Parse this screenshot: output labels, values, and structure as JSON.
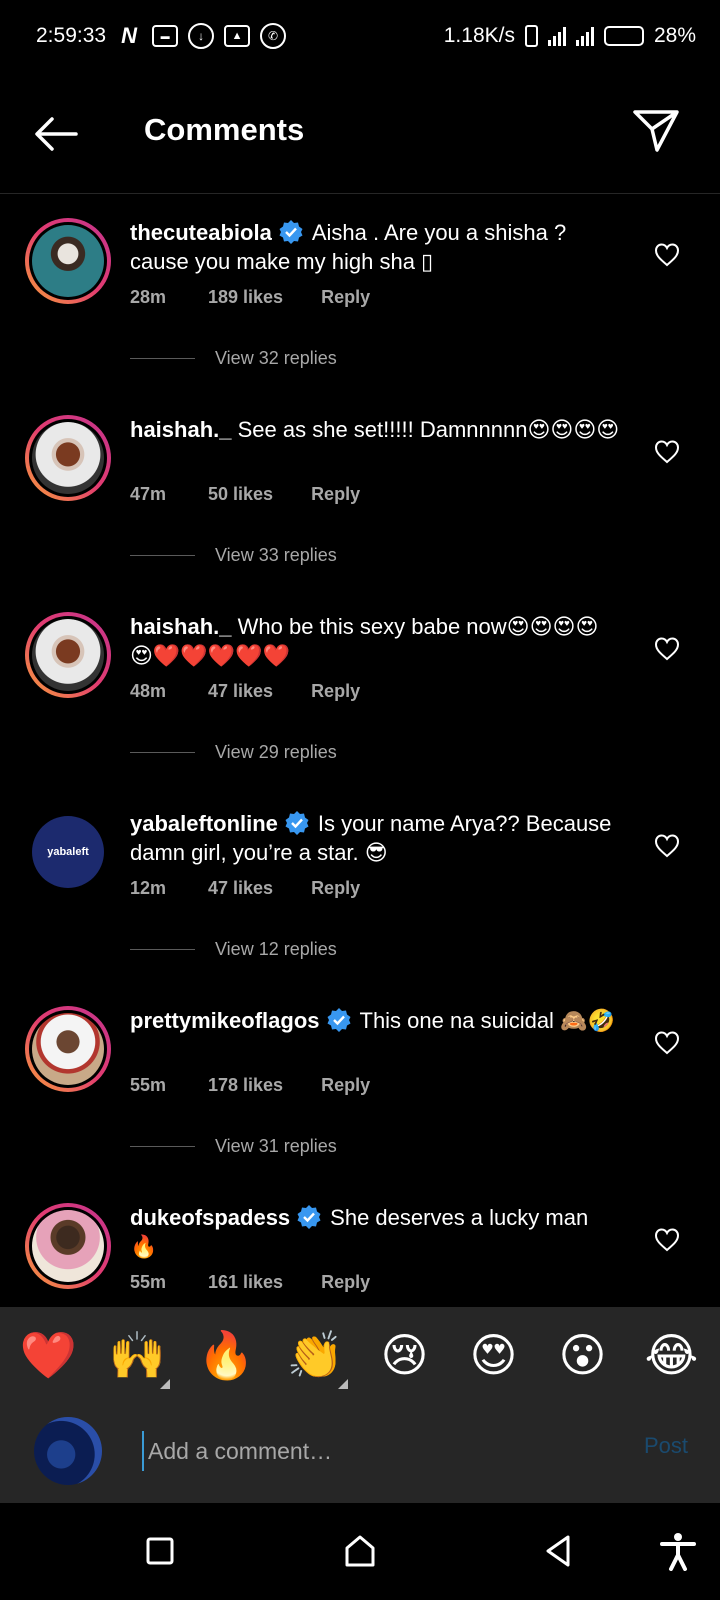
{
  "status_bar": {
    "time": "2:59:33",
    "net_speed": "1.18K/s",
    "battery": "28%",
    "battery_level": 0.28
  },
  "header": {
    "title": "Comments"
  },
  "comments": [
    {
      "username": "thecuteabiola",
      "verified": true,
      "text": "Aisha . Are you a shisha ? cause you make my high sha ▯",
      "time": "28m",
      "likes": "189 likes",
      "reply": "Reply",
      "view_replies": "View 32 replies"
    },
    {
      "username": "haishah._",
      "verified": false,
      "text": "See as she set!!!!! Damnnnnn😍😍😍😍",
      "time": "47m",
      "likes": "50 likes",
      "reply": "Reply",
      "view_replies": "View 33 replies"
    },
    {
      "username": "haishah._",
      "verified": false,
      "text": "Who be this sexy babe now😍😍😍😍😍❤️❤️❤️❤️❤️",
      "time": "48m",
      "likes": "47 likes",
      "reply": "Reply",
      "view_replies": "View 29 replies"
    },
    {
      "username": "yabaleftonline",
      "verified": true,
      "text": "Is your name Arya?? Because damn girl, you’re a star. 😎",
      "time": "12m",
      "likes": "47 likes",
      "reply": "Reply",
      "view_replies": "View 12 replies",
      "avatar_label": "yabaleft"
    },
    {
      "username": "prettymikeoflagos",
      "verified": true,
      "text": "This one na suicidal 🙈🤣",
      "time": "55m",
      "likes": "178 likes",
      "reply": "Reply",
      "view_replies": "View 31 replies"
    },
    {
      "username": "dukeofspadess",
      "verified": true,
      "text": "She deserves a lucky man 🔥",
      "time": "55m",
      "likes": "161 likes",
      "reply": "Reply"
    }
  ],
  "emoji_bar": [
    "❤️",
    "🙌",
    "🔥",
    "👏",
    "😢",
    "😍",
    "😮",
    "😂"
  ],
  "composer": {
    "placeholder": "Add a comment…",
    "post_label": "Post"
  },
  "colors": {
    "verified": "#3897f0",
    "ring_start": "#f9a13a",
    "ring_end": "#c2338f",
    "post_disabled": "#1a4a6e"
  }
}
